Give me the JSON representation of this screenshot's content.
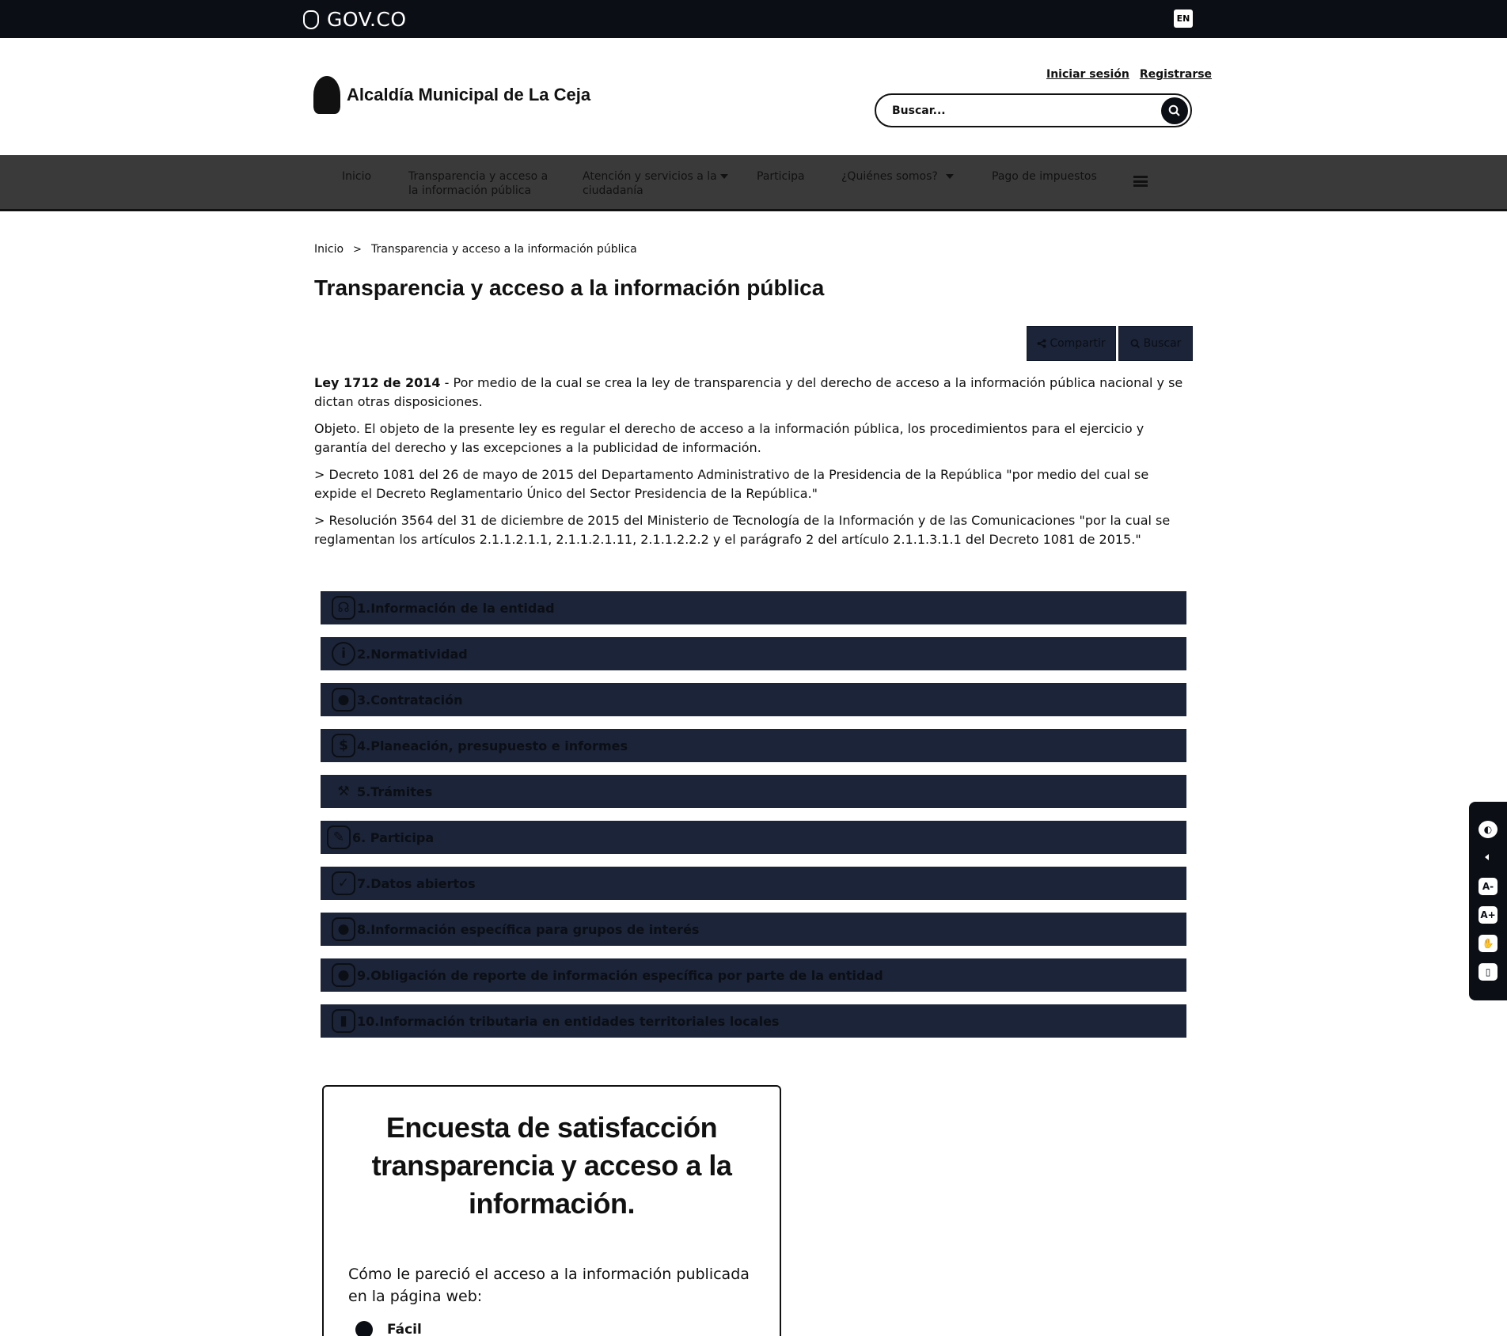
{
  "govbar": {
    "brand": "GOV.CO",
    "lang": "EN"
  },
  "header": {
    "site_name": "Alcaldía Municipal de La Ceja",
    "login": "Iniciar sesión",
    "register": "Registrarse",
    "search_placeholder": "Buscar..."
  },
  "nav": {
    "items": [
      {
        "label": "Inicio"
      },
      {
        "label": "Transparencia y acceso a la información pública"
      },
      {
        "label": "Atención y servicios a la ciudadanía"
      },
      {
        "label": "Participa"
      },
      {
        "label": "¿Quiénes somos?"
      },
      {
        "label": "Pago de impuestos"
      }
    ]
  },
  "breadcrumb": {
    "home": "Inicio",
    "separator": ">",
    "current": "Transparencia y acceso a la información pública"
  },
  "page": {
    "title": "Transparencia y acceso a la información pública",
    "share_label": "Compartir",
    "search_label": "Buscar",
    "law_title": "Ley 1712 de 2014",
    "law_text": " - Por medio de la cual se crea la ley de transparencia y del derecho de acceso a la información pública nacional y se dictan otras disposiciones.",
    "objective": "Objeto. El objeto de la presente ley es regular el derecho de acceso a la información pública, los procedimientos para el ejercicio y garantía del derecho y las excepciones a la publicidad de información.",
    "decree": "> Decreto 1081 del 26 de mayo de 2015 del Departamento Administrativo de la Presidencia de la República \"por medio del cual se expide el Decreto Reglamentario Único del Sector Presidencia de la República.\"",
    "resolution": "> Resolución 3564 del 31 de diciembre de 2015 del Ministerio de Tecnología de la Información y de las Comunicaciones \"por la cual se reglamentan los artículos 2.1.1.2.1.1, 2.1.1.2.1.11, 2.1.1.2.2.2 y el parágrafo 2 del artículo 2.1.1.3.1.1 del Decreto 1081 de 2015.\""
  },
  "accordion": [
    {
      "label": "1.Información de la entidad",
      "icon": "headset-icon"
    },
    {
      "label": "2.Normatividad",
      "icon": "info-icon"
    },
    {
      "label": "3.Contratación",
      "icon": "user-icon"
    },
    {
      "label": "4.Planeación, presupuesto e informes",
      "icon": "dollar-icon"
    },
    {
      "label": "5.Trámites",
      "icon": "gavel-icon"
    },
    {
      "label": "6. Participa",
      "icon": "pencil-icon"
    },
    {
      "label": "7.Datos abiertos",
      "icon": "check-icon"
    },
    {
      "label": "8.Información específica para grupos de interés",
      "icon": "user-icon"
    },
    {
      "label": "9.Obligación de reporte de información específica por parte de la entidad",
      "icon": "user-icon"
    },
    {
      "label": "10.Información tributaria en entidades territoriales locales",
      "icon": "document-icon"
    }
  ],
  "survey": {
    "title": "Encuesta de satisfacción transparencia y acceso a la información.",
    "question": "Cómo le pareció el acceso a la información publicada en la página web:",
    "option": "Fácil"
  }
}
